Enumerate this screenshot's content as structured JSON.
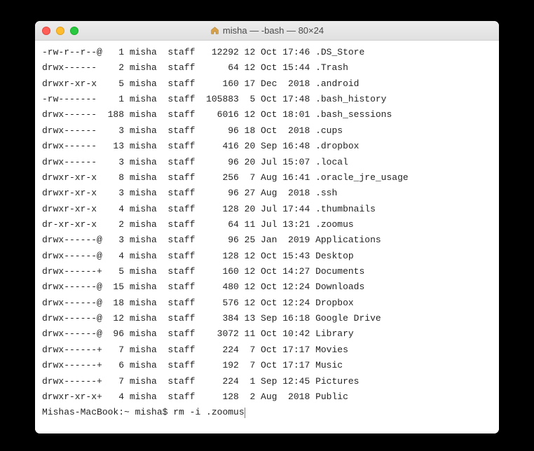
{
  "window": {
    "title": "misha — -bash — 80×24"
  },
  "listing": [
    {
      "perms": "-rw-r--r--@",
      "links": "1",
      "owner": "misha",
      "group": "staff",
      "size": "12292",
      "date": "12 Oct 17:46",
      "name": ".DS_Store"
    },
    {
      "perms": "drwx------ ",
      "links": "2",
      "owner": "misha",
      "group": "staff",
      "size": "64",
      "date": "12 Oct 15:44",
      "name": ".Trash"
    },
    {
      "perms": "drwxr-xr-x ",
      "links": "5",
      "owner": "misha",
      "group": "staff",
      "size": "160",
      "date": "17 Dec  2018",
      "name": ".android"
    },
    {
      "perms": "-rw------- ",
      "links": "1",
      "owner": "misha",
      "group": "staff",
      "size": "105883",
      "date": " 5 Oct 17:48",
      "name": ".bash_history"
    },
    {
      "perms": "drwx------ ",
      "links": "188",
      "owner": "misha",
      "group": "staff",
      "size": "6016",
      "date": "12 Oct 18:01",
      "name": ".bash_sessions"
    },
    {
      "perms": "drwx------ ",
      "links": "3",
      "owner": "misha",
      "group": "staff",
      "size": "96",
      "date": "18 Oct  2018",
      "name": ".cups"
    },
    {
      "perms": "drwx------ ",
      "links": "13",
      "owner": "misha",
      "group": "staff",
      "size": "416",
      "date": "20 Sep 16:48",
      "name": ".dropbox"
    },
    {
      "perms": "drwx------ ",
      "links": "3",
      "owner": "misha",
      "group": "staff",
      "size": "96",
      "date": "20 Jul 15:07",
      "name": ".local"
    },
    {
      "perms": "drwxr-xr-x ",
      "links": "8",
      "owner": "misha",
      "group": "staff",
      "size": "256",
      "date": " 7 Aug 16:41",
      "name": ".oracle_jre_usage"
    },
    {
      "perms": "drwxr-xr-x ",
      "links": "3",
      "owner": "misha",
      "group": "staff",
      "size": "96",
      "date": "27 Aug  2018",
      "name": ".ssh"
    },
    {
      "perms": "drwxr-xr-x ",
      "links": "4",
      "owner": "misha",
      "group": "staff",
      "size": "128",
      "date": "20 Jul 17:44",
      "name": ".thumbnails"
    },
    {
      "perms": "dr-xr-xr-x ",
      "links": "2",
      "owner": "misha",
      "group": "staff",
      "size": "64",
      "date": "11 Jul 13:21",
      "name": ".zoomus"
    },
    {
      "perms": "drwx------@",
      "links": "3",
      "owner": "misha",
      "group": "staff",
      "size": "96",
      "date": "25 Jan  2019",
      "name": "Applications"
    },
    {
      "perms": "drwx------@",
      "links": "4",
      "owner": "misha",
      "group": "staff",
      "size": "128",
      "date": "12 Oct 15:43",
      "name": "Desktop"
    },
    {
      "perms": "drwx------+",
      "links": "5",
      "owner": "misha",
      "group": "staff",
      "size": "160",
      "date": "12 Oct 14:27",
      "name": "Documents"
    },
    {
      "perms": "drwx------@",
      "links": "15",
      "owner": "misha",
      "group": "staff",
      "size": "480",
      "date": "12 Oct 12:24",
      "name": "Downloads"
    },
    {
      "perms": "drwx------@",
      "links": "18",
      "owner": "misha",
      "group": "staff",
      "size": "576",
      "date": "12 Oct 12:24",
      "name": "Dropbox"
    },
    {
      "perms": "drwx------@",
      "links": "12",
      "owner": "misha",
      "group": "staff",
      "size": "384",
      "date": "13 Sep 16:18",
      "name": "Google Drive"
    },
    {
      "perms": "drwx------@",
      "links": "96",
      "owner": "misha",
      "group": "staff",
      "size": "3072",
      "date": "11 Oct 10:42",
      "name": "Library"
    },
    {
      "perms": "drwx------+",
      "links": "7",
      "owner": "misha",
      "group": "staff",
      "size": "224",
      "date": " 7 Oct 17:17",
      "name": "Movies"
    },
    {
      "perms": "drwx------+",
      "links": "6",
      "owner": "misha",
      "group": "staff",
      "size": "192",
      "date": " 7 Oct 17:17",
      "name": "Music"
    },
    {
      "perms": "drwx------+",
      "links": "7",
      "owner": "misha",
      "group": "staff",
      "size": "224",
      "date": " 1 Sep 12:45",
      "name": "Pictures"
    },
    {
      "perms": "drwxr-xr-x+",
      "links": "4",
      "owner": "misha",
      "group": "staff",
      "size": "128",
      "date": " 2 Aug  2018",
      "name": "Public"
    }
  ],
  "prompt": {
    "prefix": "Mishas-MacBook:~ misha$ ",
    "command": "rm -i .zoomus"
  }
}
